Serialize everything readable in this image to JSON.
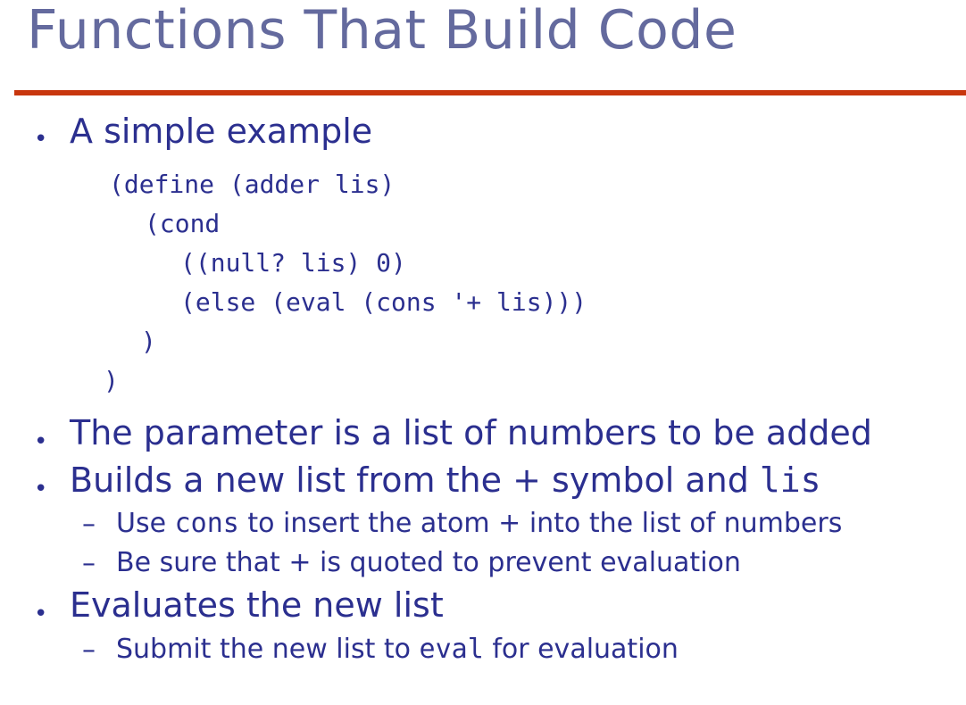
{
  "slide": {
    "title": "Functions That Build Code",
    "bullets": [
      {
        "text": "A simple example"
      },
      {
        "text": "The parameter is a list of numbers to be added"
      },
      {
        "text_before": "Builds a new list from the ",
        "sym": "+",
        "text_mid": " symbol and ",
        "code": "lis"
      },
      {
        "text": "Evaluates the new list"
      }
    ],
    "code_lines": [
      "(define (adder lis)",
      "(cond",
      "((null? lis) 0)",
      "(else (eval (cons '+ lis)))",
      ")",
      ")"
    ],
    "sub_bullets": [
      {
        "before": "Use ",
        "code": "cons",
        "mid": " to insert the atom ",
        "sym": "+",
        "after": " into the list of numbers"
      },
      {
        "before": "Be sure that ",
        "sym": "+",
        "after": " is quoted to prevent evaluation"
      },
      {
        "before": "Submit the new list to ",
        "code": "eval",
        "after": " for evaluation"
      }
    ],
    "bullet_glyph": "•",
    "dash_glyph": "–"
  }
}
